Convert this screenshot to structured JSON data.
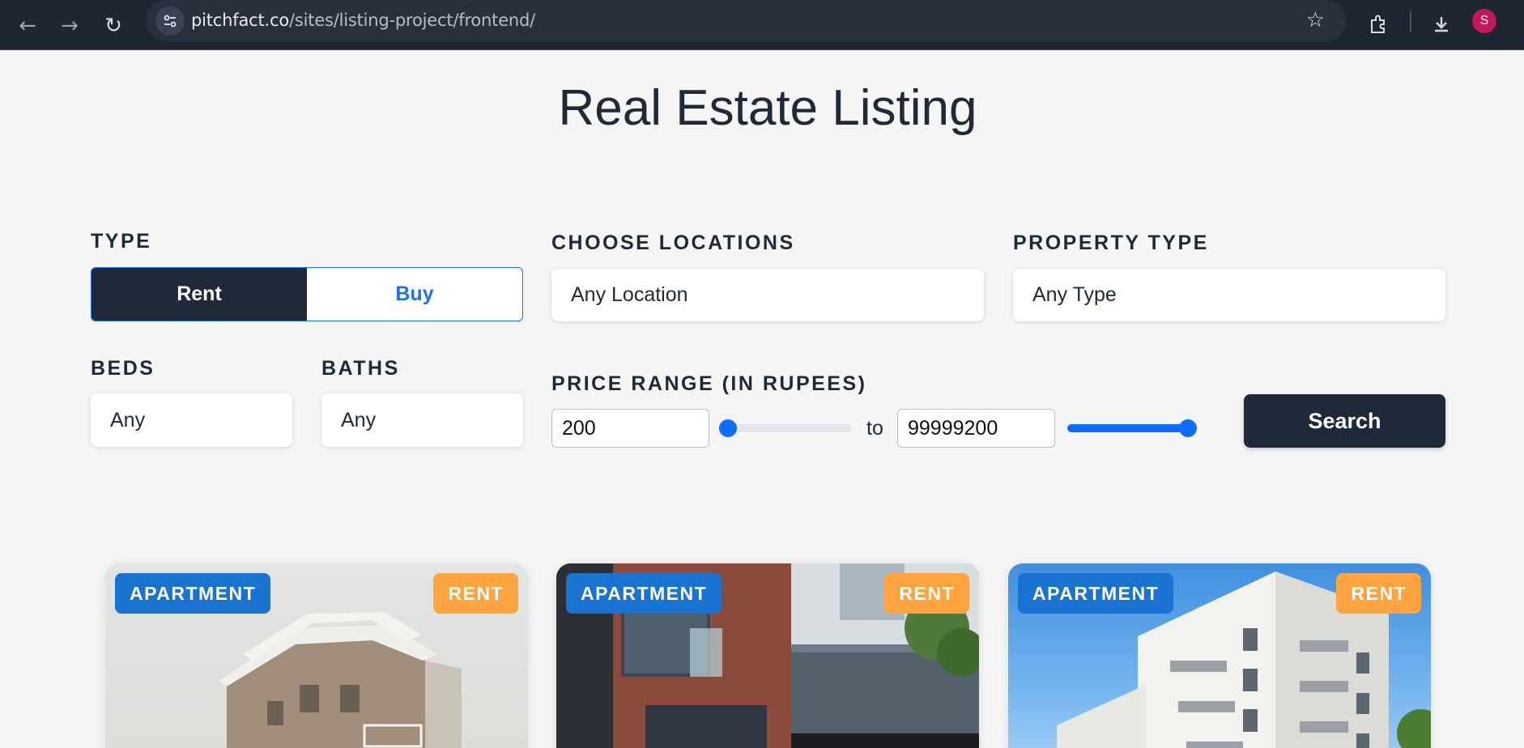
{
  "browser": {
    "url_domain": "pitchfact.co",
    "url_path": "/sites/listing-project/frontend/",
    "profile_initial": "S"
  },
  "page": {
    "title": "Real Estate Listing"
  },
  "filters": {
    "type_label": "TYPE",
    "type_options": [
      "Rent",
      "Buy"
    ],
    "type_selected": "Rent",
    "locations_label": "CHOOSE LOCATIONS",
    "locations_value": "Any Location",
    "property_type_label": "PROPERTY TYPE",
    "property_type_value": "Any Type",
    "beds_label": "BEDS",
    "beds_value": "Any",
    "baths_label": "BATHS",
    "baths_value": "Any",
    "price_label": "PRICE RANGE (IN RUPEES)",
    "price_min": "200",
    "price_max": "99999200",
    "price_to_label": "to",
    "min_slider_level": 0,
    "max_slider_level": 1,
    "search_label": "Search"
  },
  "listings": [
    {
      "type": "APARTMENT",
      "deal": "RENT"
    },
    {
      "type": "APARTMENT",
      "deal": "RENT"
    },
    {
      "type": "APARTMENT",
      "deal": "RENT"
    }
  ],
  "colors": {
    "accent": "#0d6efd",
    "dark": "#1f2937",
    "type_badge": "#1a73d1",
    "deal_badge": "#ffa43e"
  }
}
